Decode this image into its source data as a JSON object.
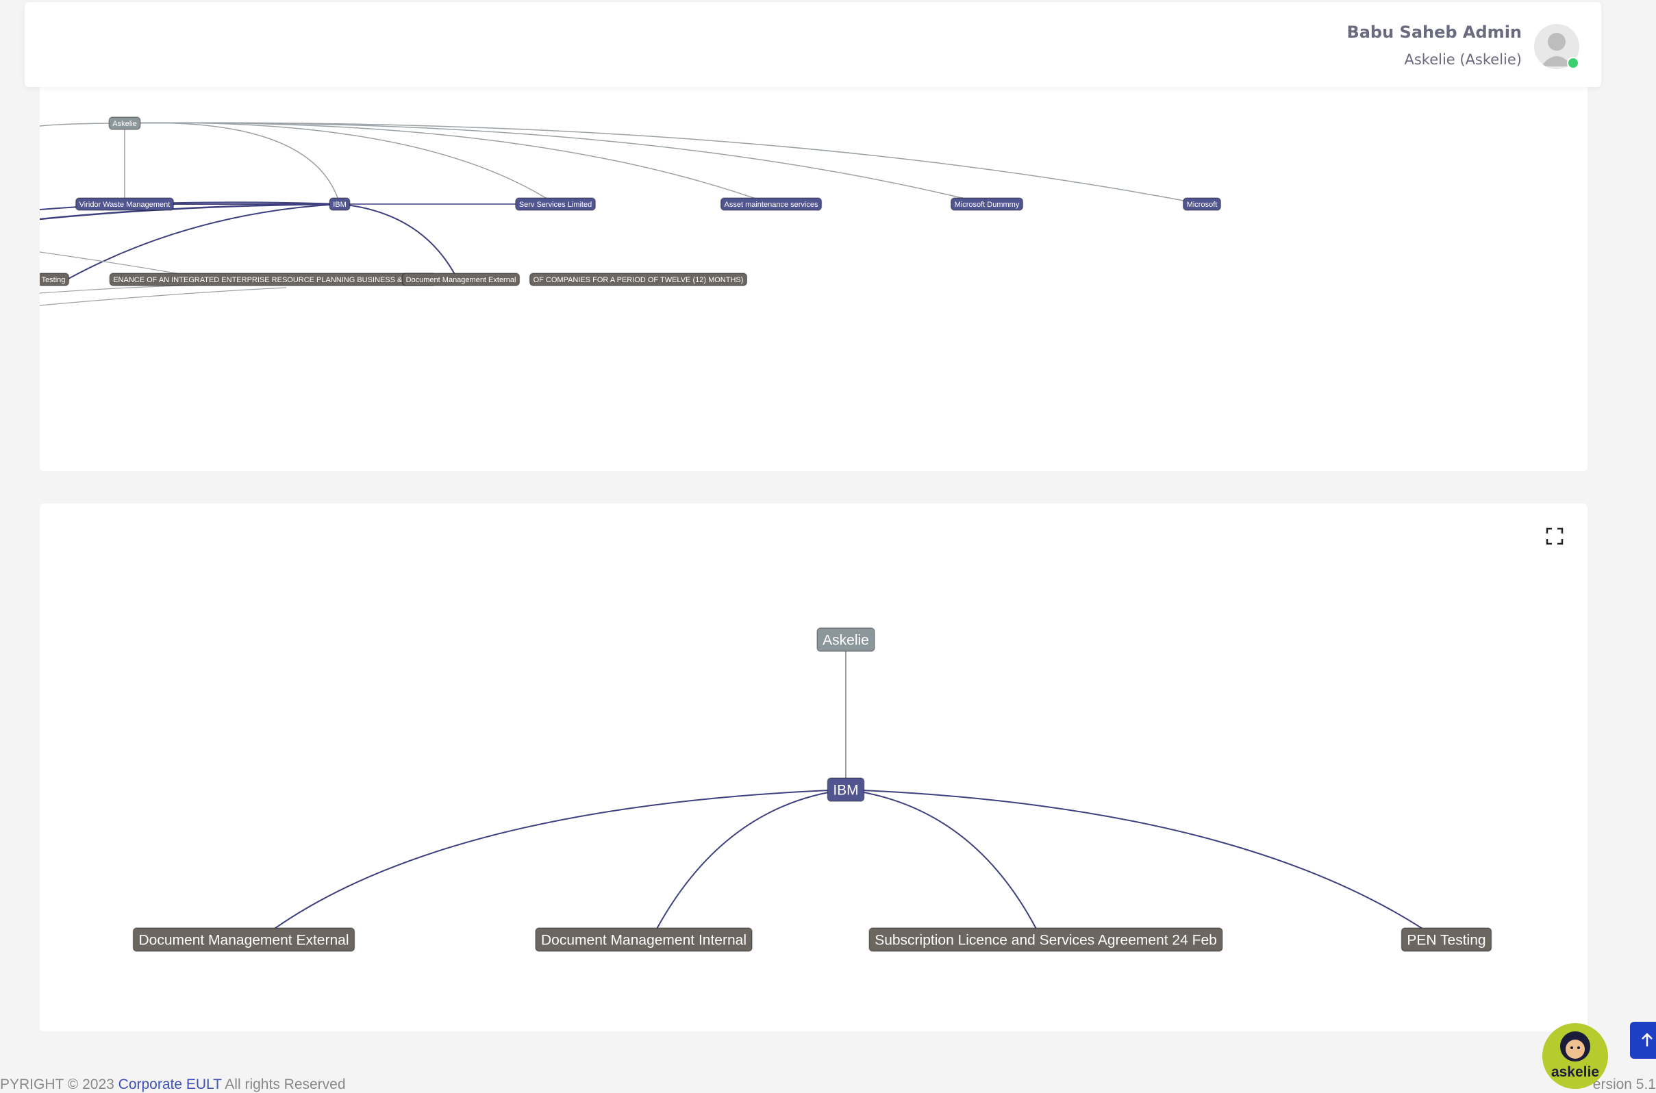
{
  "header": {
    "user_name": "Babu Saheb Admin",
    "user_org": "Askelie (Askelie)"
  },
  "graph_overview": {
    "root": "Askelie",
    "companies": [
      "Viridor Waste Management",
      "IBM",
      "Serv Services Limited",
      "Asset maintenance services",
      "Microsoft Dummmy",
      "Microsoft"
    ],
    "contracts_row": [
      "Testing",
      "ENANCE OF AN INTEGRATED ENTERPRISE RESOURCE PLANNING BUSINESS & MANAG",
      "Document Management External",
      "OF COMPANIES FOR A PERIOD OF TWELVE (12) MONTHS)"
    ]
  },
  "graph_detail": {
    "root": "Askelie",
    "company": "IBM",
    "contracts": [
      "Document Management External",
      "Document Management Internal",
      "Subscription Licence and Services Agreement 24 Feb",
      "PEN Testing"
    ]
  },
  "footer": {
    "copyright_prefix": "PYRIGHT © 2023 ",
    "copyright_link": "Corporate EULT",
    "copyright_suffix": "   All rights Reserved",
    "version": "ersion 5.1"
  },
  "bot": {
    "label": "askelie"
  },
  "colors": {
    "company_node": "#50548f",
    "root_node": "#8c979c",
    "contract_node": "#6b6660",
    "edge_company": "#3d3f7e",
    "edge_root": "#9aa1a5"
  }
}
